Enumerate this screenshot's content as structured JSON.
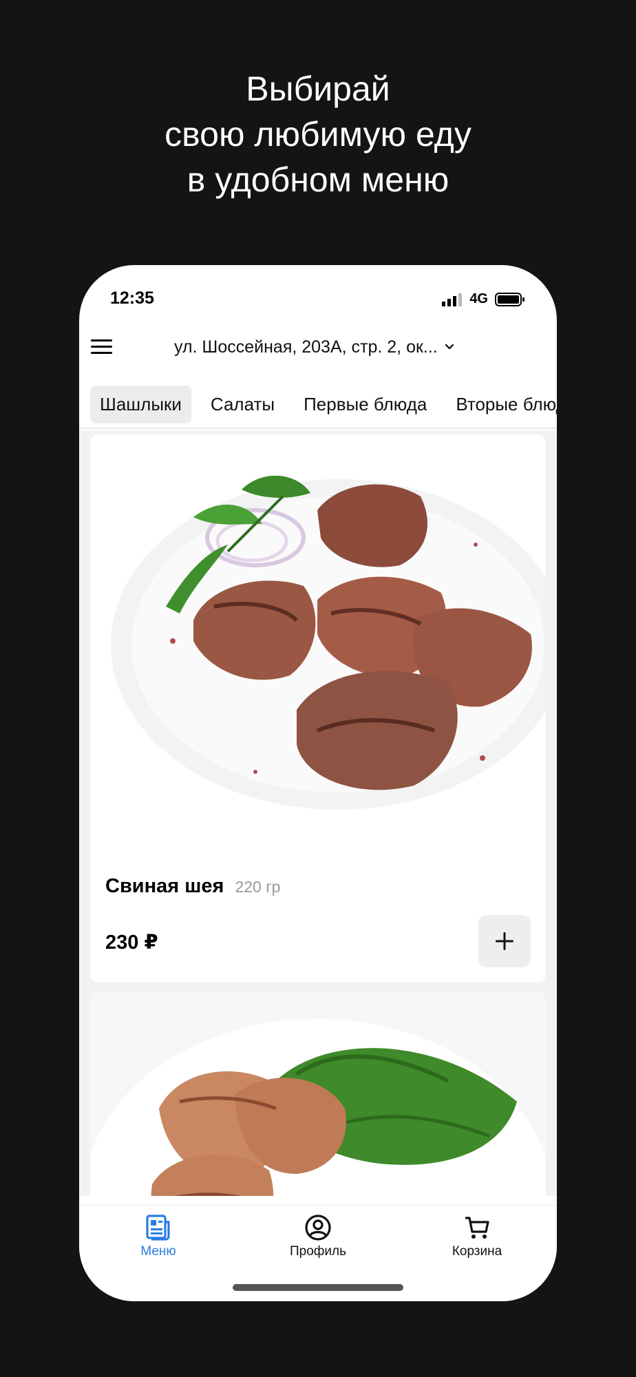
{
  "headline": {
    "line1": "Выбирай",
    "line2": "свою любимую еду",
    "line3": "в удобном меню"
  },
  "statusbar": {
    "time": "12:35",
    "network": "4G"
  },
  "header": {
    "address": "ул. Шоссейная, 203А, стр. 2, ок..."
  },
  "categories": [
    {
      "label": "Шашлыки",
      "active": true
    },
    {
      "label": "Салаты",
      "active": false
    },
    {
      "label": "Первые блюда",
      "active": false
    },
    {
      "label": "Вторые блюда",
      "active": false
    }
  ],
  "products": [
    {
      "name": "Свиная шея",
      "weight": "220 гр",
      "price": "230 ₽",
      "add_icon": "plus-icon"
    }
  ],
  "tabbar": {
    "items": [
      {
        "label": "Меню",
        "icon": "menu-doc-icon",
        "active": true
      },
      {
        "label": "Профиль",
        "icon": "profile-icon",
        "active": false
      },
      {
        "label": "Корзина",
        "icon": "cart-icon",
        "active": false
      }
    ]
  },
  "colors": {
    "background": "#141414",
    "accent": "#2a7de1"
  }
}
